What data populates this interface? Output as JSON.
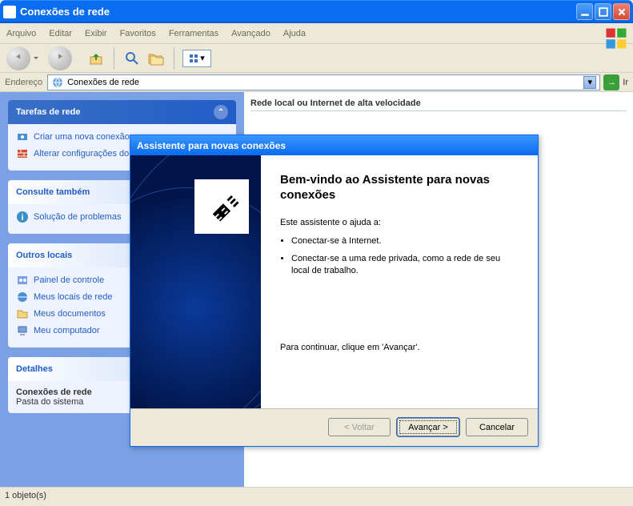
{
  "titlebar": {
    "title": "Conexões de rede"
  },
  "menu": {
    "file": "Arquivo",
    "edit": "Editar",
    "view": "Exibir",
    "fav": "Favoritos",
    "tools": "Ferramentas",
    "adv": "Avançado",
    "help": "Ajuda"
  },
  "address": {
    "label": "Endereço",
    "value": "Conexões de rede",
    "go": "Ir"
  },
  "sidebar": {
    "tasks": {
      "title": "Tarefas de rede",
      "items": [
        {
          "label": "Criar uma nova conexão"
        },
        {
          "label": "Alterar configurações do Windows"
        }
      ]
    },
    "also": {
      "title": "Consulte também",
      "items": [
        {
          "label": "Solução de problemas"
        }
      ]
    },
    "other": {
      "title": "Outros locais",
      "items": [
        {
          "label": "Painel de controle"
        },
        {
          "label": "Meus locais de rede"
        },
        {
          "label": "Meus documentos"
        },
        {
          "label": "Meu computador"
        }
      ]
    },
    "details": {
      "title": "Detalhes",
      "name": "Conexões de rede",
      "type": "Pasta do sistema"
    }
  },
  "main": {
    "group": "Rede local ou Internet de alta velocidade"
  },
  "wizard": {
    "title": "Assistente para novas conexões",
    "heading": "Bem-vindo ao Assistente para novas conexões",
    "intro": "Este assistente o ajuda a:",
    "bullets": [
      "Conectar-se à Internet.",
      "Conectar-se a uma rede privada, como a rede de seu local de trabalho."
    ],
    "continue": "Para continuar, clique em 'Avançar'.",
    "back": "< Voltar",
    "next": "Avançar >",
    "cancel": "Cancelar"
  },
  "status": {
    "text": "1 objeto(s)"
  }
}
